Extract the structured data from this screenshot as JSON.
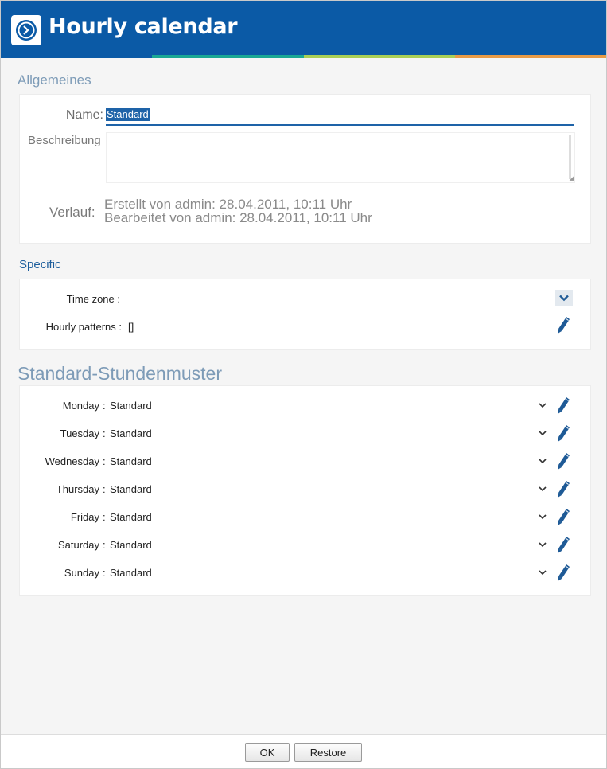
{
  "window": {
    "title": "Hourly calendar",
    "header_color": "#0b5aa6",
    "strip_colors": [
      "#0b5aa6",
      "#1aa894",
      "#a9cf56",
      "#e89b46"
    ],
    "app_icon": "clock-icon"
  },
  "general": {
    "section_title": "Allgemeines",
    "name_label": "Name:",
    "name_value": "Standard",
    "description_label": "Beschreibung",
    "description_value": "",
    "history_label": "Verlauf:",
    "created": "Erstellt von admin: 28.04.2011, 10:11 Uhr",
    "modified": "Bearbeitet von admin: 28.04.2011, 10:11 Uhr"
  },
  "specific": {
    "section_title": "Specific",
    "time_zone_label": "Time zone :",
    "time_zone_value": "",
    "hourly_patterns_label": "Hourly patterns :",
    "hourly_patterns_value": "[]"
  },
  "default_patterns": {
    "section_title": "Standard-Stundenmuster",
    "days": [
      {
        "label": "Monday",
        "value": "Standard"
      },
      {
        "label": "Tuesday",
        "value": "Standard"
      },
      {
        "label": "Wednesday",
        "value": "Standard"
      },
      {
        "label": "Thursday",
        "value": "Standard"
      },
      {
        "label": "Friday",
        "value": "Standard"
      },
      {
        "label": "Saturday",
        "value": "Standard"
      },
      {
        "label": "Sunday",
        "value": "Standard"
      }
    ],
    "colon": ":"
  },
  "footer": {
    "ok_label": "OK",
    "restore_label": "Restore"
  },
  "icons": {
    "edit": "pencil-icon",
    "dropdown": "chevron-down-icon"
  }
}
